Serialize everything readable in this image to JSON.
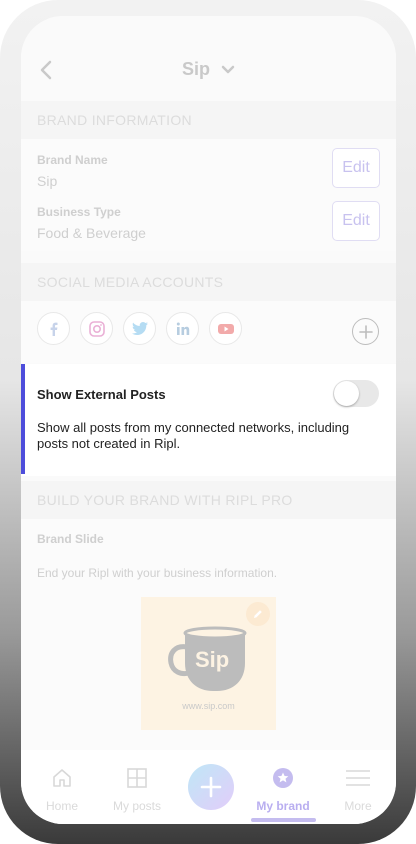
{
  "header": {
    "title": "Sip"
  },
  "brand_information": {
    "section_title": "BRAND INFORMATION",
    "brand_name_label": "Brand Name",
    "brand_name_value": "Sip",
    "business_type_label": "Business Type",
    "business_type_value": "Food & Beverage",
    "edit_label": "Edit"
  },
  "social_media": {
    "section_title": "SOCIAL MEDIA ACCOUNTS",
    "accounts": [
      {
        "icon": "facebook-icon",
        "color": "#c7d3ea"
      },
      {
        "icon": "instagram-icon",
        "color": "#eab0d6"
      },
      {
        "icon": "twitter-icon",
        "color": "#b5dcf3"
      },
      {
        "icon": "linkedin-icon",
        "color": "#b7cde0"
      },
      {
        "icon": "youtube-icon",
        "color": "#f2aaaa"
      }
    ]
  },
  "external_posts": {
    "title": "Show External Posts",
    "description": "Show all posts from my connected networks, including posts not created in Ripl.",
    "enabled": false,
    "accent": "#4d4ddb"
  },
  "ripl_pro": {
    "section_title": "BUILD YOUR BRAND WITH RIPL PRO",
    "brand_slide_label": "Brand Slide",
    "brand_slide_description": "End your Ripl with your business information.",
    "slide_logo_text": "Sip",
    "slide_url": "www.sip.com"
  },
  "tabbar": {
    "items": [
      {
        "label": "Home",
        "icon": "home-icon"
      },
      {
        "label": "My posts",
        "icon": "grid-icon"
      },
      {
        "label": "My brand",
        "icon": "star-badge-icon",
        "active": true
      },
      {
        "label": "More",
        "icon": "menu-icon"
      }
    ]
  }
}
